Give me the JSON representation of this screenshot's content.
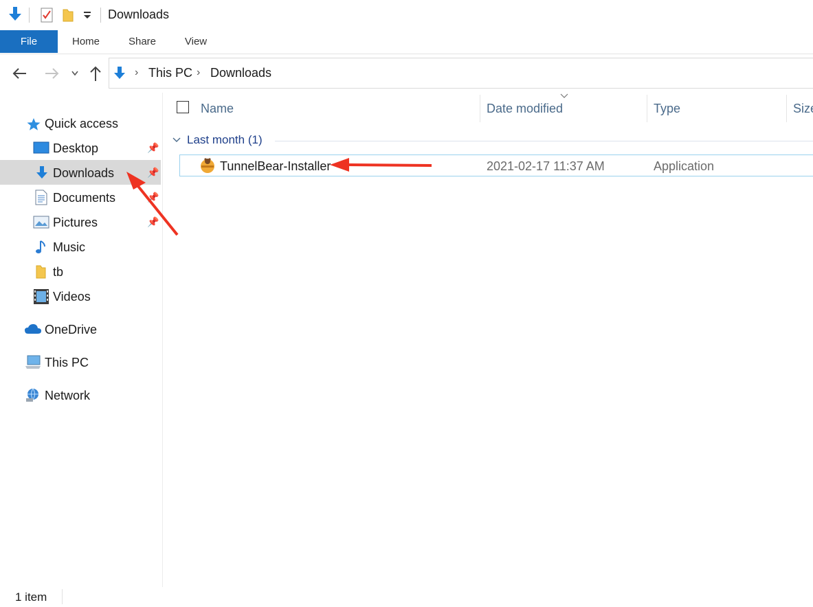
{
  "window": {
    "title": "Downloads"
  },
  "ribbon": {
    "tabs": [
      "File",
      "Home",
      "Share",
      "View"
    ]
  },
  "address": {
    "crumbs": [
      "This PC",
      "Downloads"
    ]
  },
  "sidebar": {
    "quick_access": "Quick access",
    "items": [
      {
        "label": "Desktop",
        "pinned": true,
        "icon": "desktop-icon"
      },
      {
        "label": "Downloads",
        "pinned": true,
        "icon": "download-arrow-icon",
        "selected": true
      },
      {
        "label": "Documents",
        "pinned": true,
        "icon": "document-icon"
      },
      {
        "label": "Pictures",
        "pinned": true,
        "icon": "picture-icon"
      },
      {
        "label": "Music",
        "pinned": false,
        "icon": "music-note-icon"
      },
      {
        "label": "tb",
        "pinned": false,
        "icon": "folder-icon"
      },
      {
        "label": "Videos",
        "pinned": false,
        "icon": "film-icon"
      }
    ],
    "onedrive": "OneDrive",
    "thispc": "This PC",
    "network": "Network"
  },
  "columns": {
    "name": "Name",
    "date": "Date modified",
    "type": "Type",
    "size": "Size"
  },
  "group": {
    "label": "Last month (1)"
  },
  "files": [
    {
      "name": "TunnelBear-Installer",
      "date": "2021-02-17 11:37 AM",
      "type": "Application"
    }
  ],
  "status": {
    "count": "1 item"
  },
  "colors": {
    "accent": "#1a6fc0",
    "annotation_arrow": "#ee3322",
    "selection": "#d9d9d9",
    "row_border": "#99d1ee"
  }
}
